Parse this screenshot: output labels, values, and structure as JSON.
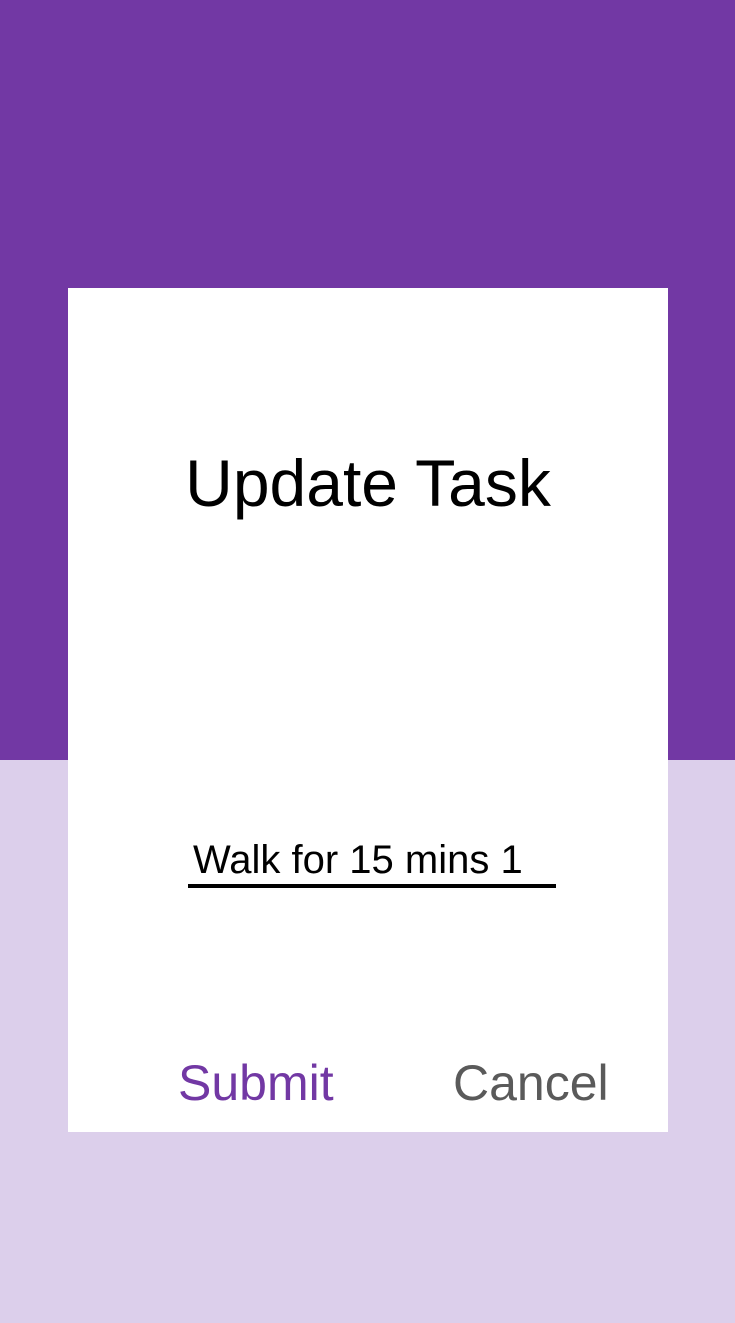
{
  "dialog": {
    "title": "Update Task",
    "task_input": {
      "value": "Walk for 15 mins 1"
    },
    "submit_label": "Submit",
    "cancel_label": "Cancel"
  },
  "colors": {
    "primary": "#7238a4",
    "primary_light": "#dccfeb",
    "surface": "#ffffff",
    "cancel_text": "#5a5a5a"
  }
}
